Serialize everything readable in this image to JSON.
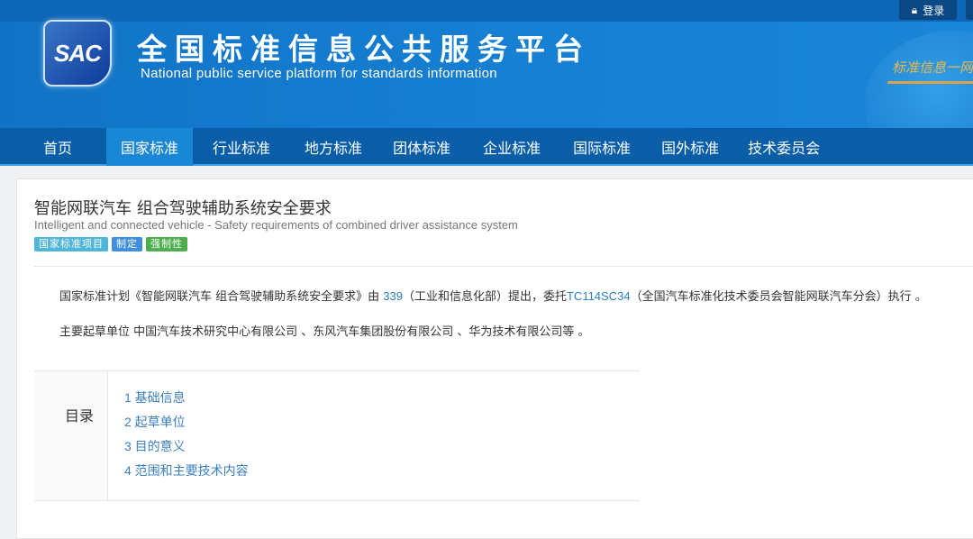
{
  "topbar": {
    "login_label": "登录"
  },
  "header": {
    "logo_text": "SAC",
    "title_cn": "全国标准信息公共服务平台",
    "title_en": "National public service platform  for standards information",
    "slogan": "标准信息一网"
  },
  "nav": {
    "items": [
      {
        "label": "首页"
      },
      {
        "label": "国家标准"
      },
      {
        "label": "行业标准"
      },
      {
        "label": "地方标准"
      },
      {
        "label": "团体标准"
      },
      {
        "label": "企业标准"
      },
      {
        "label": "国际标准"
      },
      {
        "label": "国外标准"
      },
      {
        "label": "技术委员会"
      }
    ],
    "active": "国家标准"
  },
  "standard": {
    "title_cn": "智能网联汽车 组合驾驶辅助系统安全要求",
    "title_en": "Intelligent and connected vehicle - Safety requirements of combined driver assistance system",
    "badges": [
      {
        "label": "国家标准项目",
        "color": "#4fb6da"
      },
      {
        "label": "制定",
        "color": "#3f8fdc"
      },
      {
        "label": "强制性",
        "color": "#4cae4c"
      }
    ],
    "para1": {
      "prefix": "国家标准计划《智能网联汽车 组合驾驶辅助系统安全要求》由 ",
      "org_link": "339",
      "middle": "（工业和信息化部）提出，委托",
      "tc_link": "TC114SC34",
      "suffix": "（全国汽车标准化技术委员会智能网联汽车分会）执行 。"
    },
    "para2": "主要起草单位 中国汽车技术研究中心有限公司 、东风汽车集团股份有限公司 、华为技术有限公司等 。"
  },
  "toc": {
    "label": "目录",
    "items": [
      "1  基础信息",
      "2  起草单位",
      "3  目的意义",
      "4  范围和主要技术内容"
    ]
  }
}
